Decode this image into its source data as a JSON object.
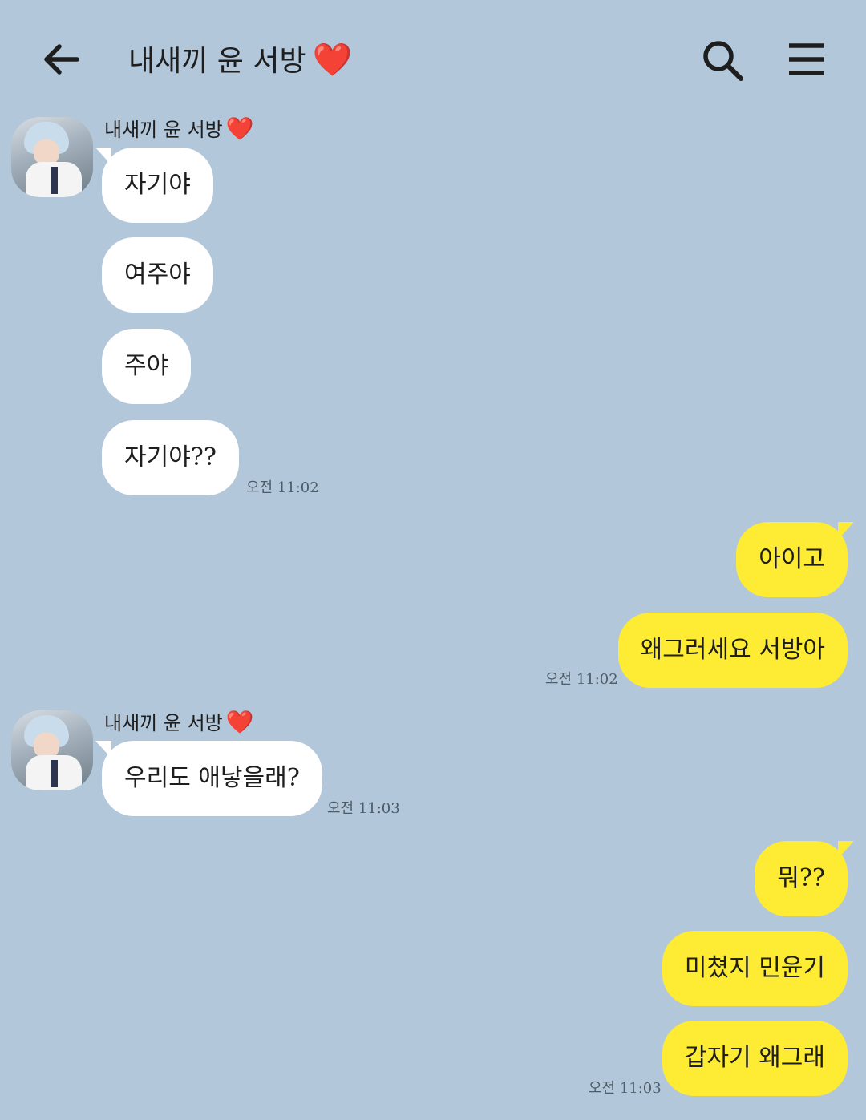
{
  "header": {
    "title": "내새끼 윤 서방",
    "title_emoji": "❤️",
    "back_icon": "arrow-left-icon",
    "search_icon": "search-icon",
    "menu_icon": "hamburger-menu-icon"
  },
  "colors": {
    "background": "#b2c7da",
    "incoming_bubble": "#ffffff",
    "outgoing_bubble": "#feeb34",
    "heart": "#e8141c"
  },
  "messages": {
    "group1": {
      "sender": "내새끼 윤 서방",
      "sender_emoji": "❤️",
      "bubbles": [
        "자기야",
        "여주야",
        "주야",
        "자기야??"
      ],
      "time": "오전 11:02"
    },
    "group2": {
      "bubbles": [
        "아이고",
        "왜그러세요 서방아"
      ],
      "time": "오전 11:02"
    },
    "group3": {
      "sender": "내새끼 윤 서방",
      "sender_emoji": "❤️",
      "bubbles": [
        "우리도 애낳을래?"
      ],
      "time": "오전 11:03"
    },
    "group4": {
      "bubbles": [
        "뭐??",
        "미쳤지 민윤기",
        "갑자기 왜그래"
      ],
      "time": "오전 11:03"
    }
  }
}
